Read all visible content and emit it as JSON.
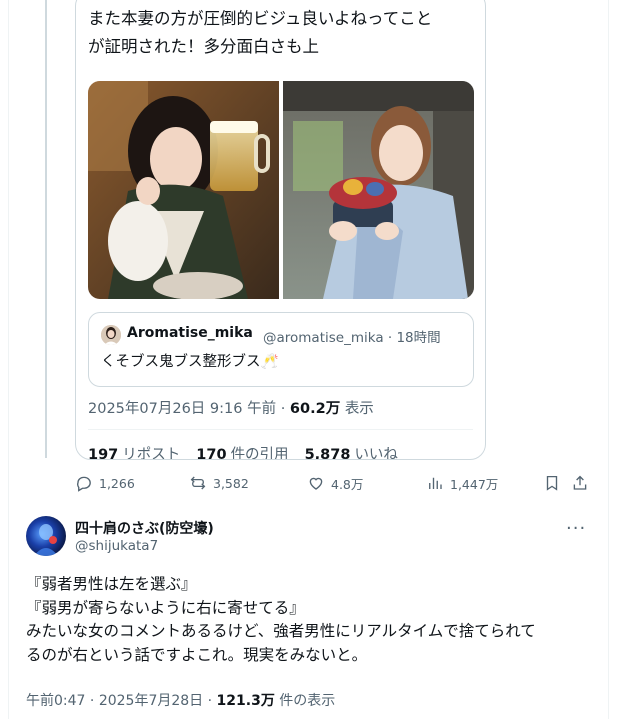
{
  "quoted": {
    "text_line1": "また本妻の方が圧倒的ビジュ良いよねってこと",
    "text_line2": "が証明された！多分面白さも上",
    "inner_quote": {
      "name": "Aromatise_mika",
      "handle_time": "@aromatise_mika · 18時間",
      "text": "くそブス鬼ブス整形ブス🥂"
    },
    "meta": {
      "timestamp": "2025年07月26日 9:16 午前",
      "views_count": "60.2万",
      "views_label": "表示"
    },
    "stats": {
      "reposts_count": "197",
      "reposts_label": "リポスト",
      "quotes_count": "170",
      "quotes_label": "件の引用",
      "likes_count": "5,878",
      "likes_label": "いいね"
    }
  },
  "actions": {
    "replies": "1,266",
    "reposts": "3,582",
    "likes": "4.8万",
    "views": "1,447万"
  },
  "tweet": {
    "author_name": "四十肩のさぶ(防空壕)",
    "author_handle": "@shijukata7",
    "more_label": "···",
    "line1": "『弱者男性は左を選ぶ』",
    "line2": "『弱男が寄らないように右に寄せてる』",
    "line3": "みたいな女のコメントあるるけど、強者男性にリアルタイムで捨てられて",
    "line4": "るのが右という話ですよこれ。現実をみないと。",
    "time": "午前0:47",
    "date": "2025年7月28日",
    "views_count": "121.3万",
    "views_label": "件の表示"
  },
  "colors": {
    "text": "#0f1419",
    "muted": "#536471",
    "border": "#cfd9de"
  }
}
